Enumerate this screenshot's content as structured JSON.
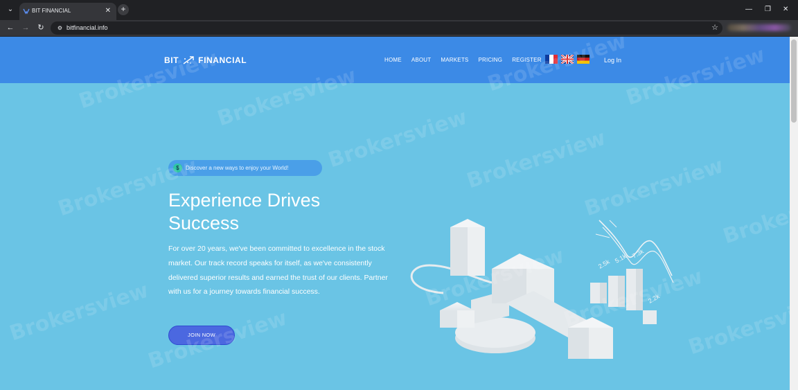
{
  "browser": {
    "tab_title": "BIT FINANCIAL",
    "url": "bitfinancial.info"
  },
  "site": {
    "logo_left": "BIT",
    "logo_right": "FINANCIAL",
    "nav": [
      "HOME",
      "ABOUT",
      "MARKETS",
      "PRICING",
      "REGISTER"
    ],
    "languages": [
      "French",
      "English",
      "German"
    ],
    "login_label": "Log In"
  },
  "hero": {
    "badge_icon": "$",
    "badge_text": "Discover a new ways to enjoy your World!",
    "title_line1": "Experience Drives",
    "title_line2": "Success",
    "paragraph": "For over 20 years, we've been committed to excellence in the stock market. Our track record speaks for itself, as we've consistently delivered superior results and earned the trust of our clients. Partner with us for a journey towards financial success.",
    "cta_label": "JOIN NOW",
    "chart_labels": [
      "2.5k",
      "5.1k",
      "7.3k",
      "2.2k"
    ]
  },
  "watermark": "Brokersview",
  "colors": {
    "header": "#3c8ae6",
    "hero_bg": "#6ac4e5",
    "cta": "#4b68e0"
  }
}
